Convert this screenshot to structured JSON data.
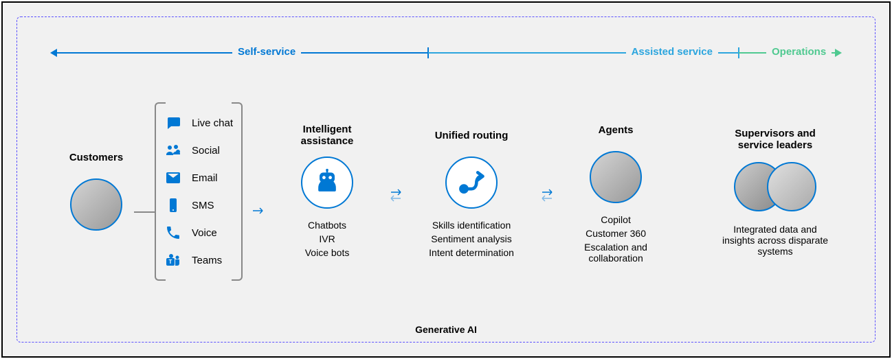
{
  "topbar": {
    "self_service": "Self-service",
    "assisted_service": "Assisted service",
    "operations": "Operations"
  },
  "customers": {
    "title": "Customers"
  },
  "channels": {
    "items": [
      {
        "icon": "chat-icon",
        "label": "Live chat"
      },
      {
        "icon": "social-icon",
        "label": "Social"
      },
      {
        "icon": "email-icon",
        "label": "Email"
      },
      {
        "icon": "sms-icon",
        "label": "SMS"
      },
      {
        "icon": "voice-icon",
        "label": "Voice"
      },
      {
        "icon": "teams-icon",
        "label": "Teams"
      }
    ]
  },
  "intelligent": {
    "title": "Intelligent assistance",
    "items": [
      "Chatbots",
      "IVR",
      "Voice bots"
    ]
  },
  "routing": {
    "title": "Unified routing",
    "items": [
      "Skills identification",
      "Sentiment analysis",
      "Intent determination"
    ]
  },
  "agents": {
    "title": "Agents",
    "items": [
      "Copilot",
      "Customer 360",
      "Escalation and collaboration"
    ]
  },
  "supervisors": {
    "title": "Supervisors and service leaders",
    "description": "Integrated data and insights across disparate systems"
  },
  "footer": {
    "label": "Generative AI"
  }
}
